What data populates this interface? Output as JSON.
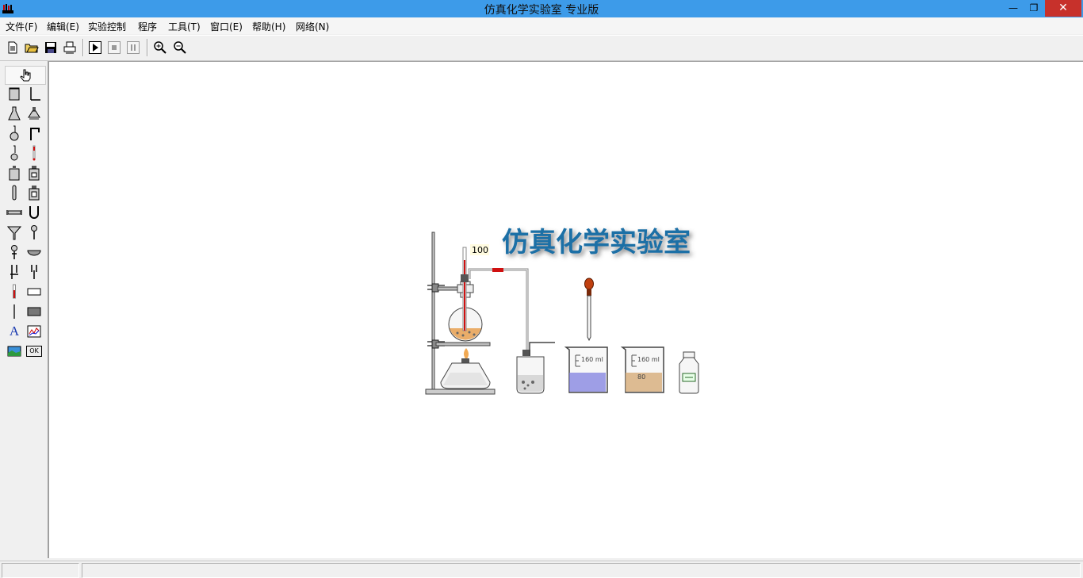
{
  "window": {
    "title": "仿真化学实验室 专业版",
    "minimize_glyph": "—",
    "restore_glyph": "❐",
    "close_glyph": "✕"
  },
  "menu": [
    {
      "label": "文件(F)"
    },
    {
      "label": "编辑(E)"
    },
    {
      "label": "实验控制"
    },
    {
      "label": "程序"
    },
    {
      "label": "工具(T)"
    },
    {
      "label": "窗口(E)"
    },
    {
      "label": "帮助(H)"
    },
    {
      "label": "网络(N)"
    }
  ],
  "toolbar": [
    {
      "icon": "new-file-icon"
    },
    {
      "icon": "open-folder-icon"
    },
    {
      "icon": "save-icon"
    },
    {
      "icon": "print-icon"
    },
    {
      "icon": "run-icon"
    },
    {
      "icon": "stop-icon"
    },
    {
      "icon": "pause-icon"
    },
    {
      "icon": "zoom-in-icon"
    },
    {
      "icon": "zoom-out-icon"
    }
  ],
  "palette": {
    "pointer_icon": "hand-pointer-icon",
    "tools": [
      "beaker-icon",
      "iron-stand-icon",
      "conical-flask-icon",
      "separatory-funnel-icon",
      "round-flask-icon",
      "bent-tube-icon",
      "flat-flask-icon",
      "thermometer-icon",
      "reagent-bottle-icon",
      "wide-bottle-icon",
      "test-tube-icon",
      "gas-bottle-icon",
      "drying-tube-icon",
      "u-tube-icon",
      "funnel-icon",
      "dropper-icon",
      "dropping-funnel-icon",
      "evaporating-dish-icon",
      "electrode-icon",
      "electrode-pair-icon",
      "red-thermometer-icon",
      "rectangle-icon",
      "glass-rod-icon",
      "filled-rectangle-icon",
      "text-icon",
      "chart-icon",
      "image-icon",
      "ok-button-icon"
    ],
    "text_tool_glyph": "A",
    "ok_glyph": "OK"
  },
  "scene": {
    "logo_text": "仿真化学实验室",
    "thermometer_reading": "100",
    "beaker1_label": "160 ml",
    "beaker2_label": "160 ml",
    "beaker2_mark": "80",
    "colors": {
      "logo": "#1c6fa6",
      "purple_liquid": "#8080e0",
      "tan_liquid": "#d8b080",
      "dropper_bulb": "#c04010",
      "red_joint": "#d01010",
      "flame": "#f0a040"
    }
  },
  "statusbar": {
    "pane1": "",
    "pane2": ""
  }
}
